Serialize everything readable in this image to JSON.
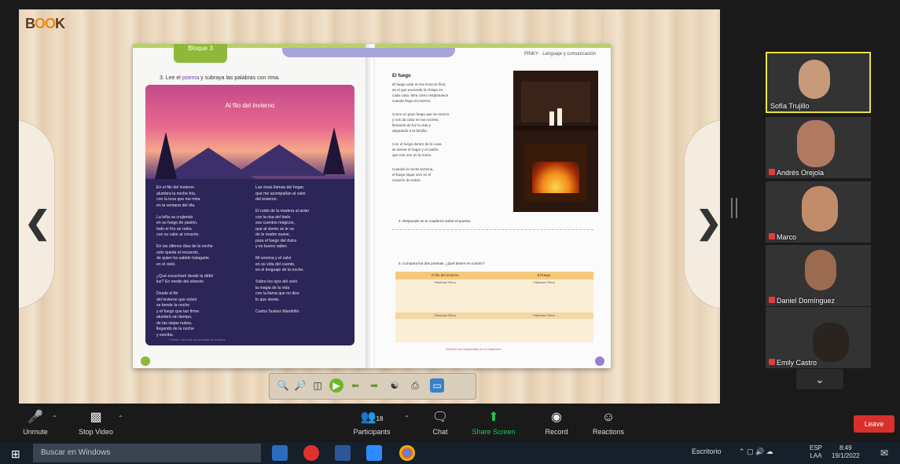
{
  "share": {
    "logo": {
      "pre": "B",
      "mid": "OO",
      "post": "K"
    },
    "book": {
      "block_tab": "Bloque 3",
      "instruction_pre": "3. Lee el ",
      "instruction_hl": "poema",
      "instruction_post": " y subraya las palabras con rima.",
      "poem_title": "Al filo del invierno",
      "poem_col1": "En el filo del invierno\nalumbra la noche fría,\ncon la luna que me mira\nen la ventana del día.\n\nLa leña va crujiendo\nen su fuego de pasión,\ntodo el frío se retira\ncon su calor al corazón.\n\nEn los últimos días de la noche\nsolo queda el recuerdo,\nde quien ha sabido halagarte\nen el cielo.\n\n¿Qué escucharé desde la débil\nluz? En medio del silencio\n\nDesde el fin\ndel invierno que volvió\nse tiende la noche\ny el fuego que tan firme\nalumbró sin tiempo,\nde las viejas nubes,\nllegando de la noche\ny escribe.",
      "poem_col2": "Las vivas llamas del hogar,\nque me acompañan al calor\ndel invierno.\n\nEl ruido de la madera al arder\ncon la risa del hielo\nsus cuentos mágicos,\nque al viento se le va\nde la madre suave,\npara el fuego del dulce\ny es bueno saber.\n\nMi sonrisa y el calor\nen su vida del cuento,\nen el lenguaje de la noche.\n\nSobre los ojos del cielo\nla magia de la vida\ncon la llama que no dice\nlo que siente.\n\nCarlos Suárez Mandrillo",
      "poem_footer": "Fuente: sitio web de poemas de invierno",
      "right_header": "PINKY · Lenguaje y comunicación",
      "fuego_title": "El fuego",
      "right_para1": "El fuego arde en los troncos fríos;\nes el que enciende la chispa en\ncada casa. Mira cómo resplandece\ncuando llega el invierno.",
      "right_para2": "Como un gran fuego que se acerca\ny nos da calor en las noches,\nllenando de luz la vida y\nalegrando a la familia.",
      "right_para3": "Con el fuego dentro de la casa\nse siente el hogar y el cariño\nque nos une en la mesa.",
      "right_para4": "Cuando la noche termina,\nel fuego sigue vivo en el\ncorazón de todos.",
      "activity_label": "4. Responde en tu cuaderno sobre el poema.",
      "compare_label": "5. Compara los dos poemas. ¿Qué tienen en común?",
      "table_h1": "Al filo del invierno",
      "table_h2": "El fuego",
      "table_sub1": "Palabras/ Rima",
      "table_sub2": "Palabras/ Rima",
      "table_r3a": "Palabras/ Rima",
      "table_r3b": "Palabras/ Rima",
      "pink_note": "¡Escribe tus respuestas en el cuaderno!"
    }
  },
  "participants": [
    {
      "name": "Sofía Trujillo",
      "bg": "#4a6f8a",
      "active": true
    },
    {
      "name": "Andrés Orejola",
      "bg": "#6d4a40",
      "active": false
    },
    {
      "name": "Marco",
      "bg": "#7a6a5a",
      "active": false
    },
    {
      "name": "Daniel Domínguez",
      "bg": "#8a7060",
      "active": false
    },
    {
      "name": "Emily Castro",
      "bg": "#9a8a78",
      "active": false
    }
  ],
  "zoom_controls": {
    "unmute": "Unmute",
    "stop_video": "Stop Video",
    "participants": "Participants",
    "participants_count": "18",
    "chat": "Chat",
    "share_screen": "Share Screen",
    "record": "Record",
    "reactions": "Reactions",
    "leave": "Leave"
  },
  "taskbar": {
    "search_placeholder": "Buscar en Windows",
    "tray_text": "Escritorio",
    "lang": "ESP",
    "lang_sub": "LAA",
    "time": "8:49",
    "date": "19/1/2022"
  },
  "colors": {
    "share_green": "#1ec95a",
    "leave_red": "#d9302c",
    "active_border": "#e9e24a"
  }
}
